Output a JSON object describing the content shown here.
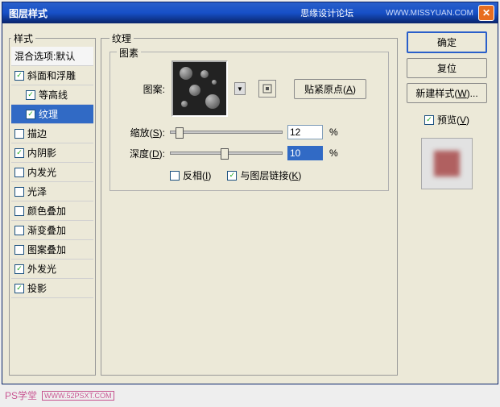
{
  "window": {
    "title": "图层样式",
    "brand": "思缘设计论坛",
    "url": "WWW.MISSYUAN.COM"
  },
  "styles_panel": {
    "legend": "样式",
    "blend_header": "混合选项:默认",
    "items": [
      {
        "label": "斜面和浮雕",
        "checked": true,
        "nested": false
      },
      {
        "label": "等高线",
        "checked": true,
        "nested": true
      },
      {
        "label": "纹理",
        "checked": true,
        "nested": true,
        "selected": true
      },
      {
        "label": "描边",
        "checked": false,
        "nested": false
      },
      {
        "label": "内阴影",
        "checked": true,
        "nested": false
      },
      {
        "label": "内发光",
        "checked": false,
        "nested": false
      },
      {
        "label": "光泽",
        "checked": false,
        "nested": false
      },
      {
        "label": "颜色叠加",
        "checked": false,
        "nested": false
      },
      {
        "label": "渐变叠加",
        "checked": false,
        "nested": false
      },
      {
        "label": "图案叠加",
        "checked": false,
        "nested": false
      },
      {
        "label": "外发光",
        "checked": true,
        "nested": false
      },
      {
        "label": "投影",
        "checked": true,
        "nested": false
      }
    ]
  },
  "main": {
    "legend": "纹理",
    "sub_legend": "图素",
    "pattern_label": "图案:",
    "snap_label_pre": "贴紧原点(",
    "snap_key": "A",
    "snap_label_post": ")",
    "scale": {
      "label_pre": "缩放(",
      "key": "S",
      "label_post": "):",
      "value": "12",
      "unit": "%"
    },
    "depth": {
      "label_pre": "深度(",
      "key": "D",
      "label_post": "):",
      "value": "10",
      "unit": "%"
    },
    "invert": {
      "label_pre": "反相(",
      "key": "I",
      "label_post": ")",
      "checked": false
    },
    "link": {
      "label_pre": "与图层链接(",
      "key": "K",
      "label_post": ")",
      "checked": true
    }
  },
  "right": {
    "ok": "确定",
    "cancel": "复位",
    "new_style_pre": "新建样式(",
    "new_style_key": "W",
    "new_style_post": ")...",
    "preview_pre": "预览(",
    "preview_key": "V",
    "preview_post": ")",
    "preview_checked": true
  },
  "watermark": {
    "text": "PS学堂",
    "url": "WWW.52PSXT.COM"
  }
}
